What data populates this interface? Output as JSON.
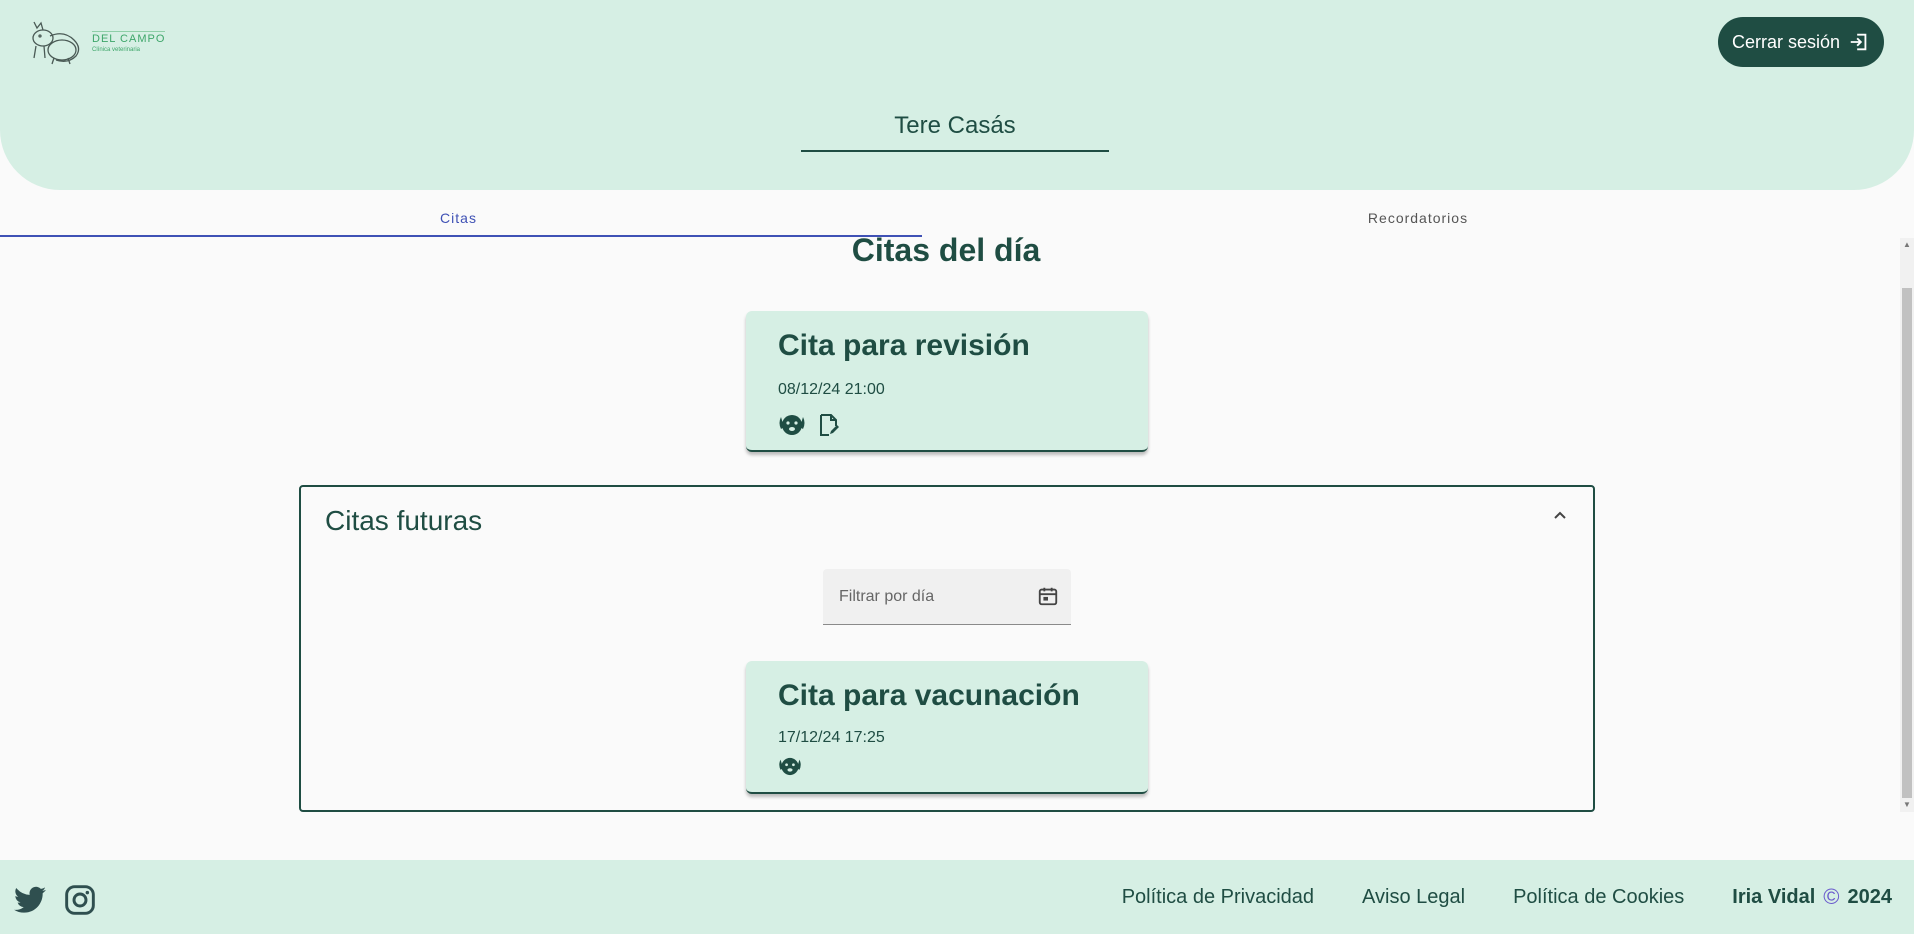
{
  "header": {
    "logo": {
      "name": "DEL CAMPO",
      "subtitle": "Clínica veterinaria"
    },
    "logout_label": "Cerrar sesión",
    "user_name": "Tere Casás"
  },
  "tabs": [
    {
      "label": "Citas",
      "active": true
    },
    {
      "label": "Recordatorios",
      "active": false
    }
  ],
  "today": {
    "title": "Citas del día",
    "appointments": [
      {
        "title": "Cita para revisión",
        "datetime": "08/12/24 21:00",
        "icons": [
          "dog-icon",
          "edit-document-icon"
        ]
      }
    ]
  },
  "future": {
    "title": "Citas futuras",
    "filter_placeholder": "Filtrar por día",
    "appointments": [
      {
        "title": "Cita para vacunación",
        "datetime": "17/12/24 17:25",
        "icons": [
          "dog-icon"
        ]
      }
    ]
  },
  "footer": {
    "links": [
      "Política de Privacidad",
      "Aviso Legal",
      "Política de Cookies"
    ],
    "author": "Iria Vidal",
    "copyright_symbol": "©",
    "year": "2024",
    "social": [
      "twitter-icon",
      "instagram-icon"
    ]
  },
  "colors": {
    "primary": "#1f4d43",
    "mint": "#d6efe4",
    "tab_active": "#3f51b5",
    "background": "#fafafa"
  }
}
